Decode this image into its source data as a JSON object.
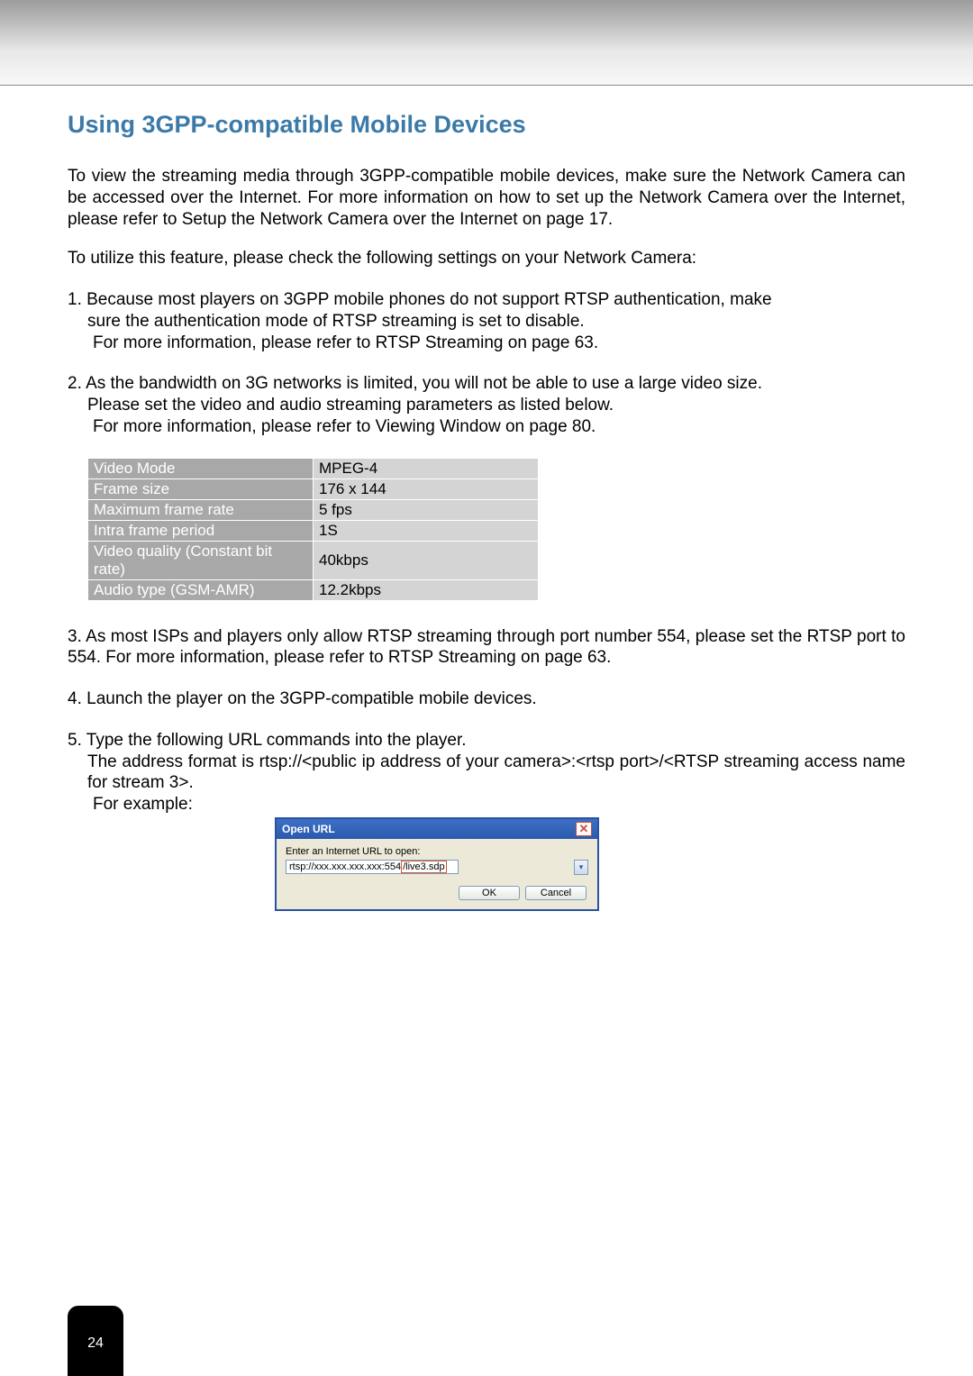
{
  "title": "Using 3GPP-compatible Mobile Devices",
  "intro": "To view the streaming media through 3GPP-compatible mobile devices, make sure the Network Camera can be accessed over the Internet. For more information on how to set up the Network Camera over the Internet, please refer to Setup the Network Camera over the Internet on page 17.",
  "lead": "To utilize this feature, please check the following settings on your Network Camera:",
  "item1_l1": "1. Because most players on 3GPP mobile phones do not support RTSP authentication, make",
  "item1_l2": "sure the authentication mode of RTSP streaming is set to disable.",
  "item1_l3": "For more information, please refer to RTSP Streaming on page 63.",
  "item2_l1": "2. As the bandwidth on 3G networks is limited, you will not be able to use a large video size.",
  "item2_l2": "Please set the video and audio streaming parameters as listed below.",
  "item2_l3": "For more information, please refer to Viewing Window on page 80.",
  "table": [
    {
      "label": "Video Mode",
      "value": "MPEG-4"
    },
    {
      "label": "Frame size",
      "value": "176 x 144"
    },
    {
      "label": "Maximum frame rate",
      "value": "5 fps"
    },
    {
      "label": "Intra frame period",
      "value": "1S"
    },
    {
      "label": "Video quality (Constant bit rate)",
      "value": "40kbps"
    },
    {
      "label": "Audio type (GSM-AMR)",
      "value": "12.2kbps"
    }
  ],
  "item3": "3. As most ISPs and players only allow RTSP streaming through port number 554, please set the RTSP port to 554. For more information, please refer to RTSP Streaming on page 63.",
  "item4": "4. Launch the player on the 3GPP-compatible mobile devices.",
  "item5_l1": "5. Type the following URL commands into the player.",
  "item5_l2": "The address format is rtsp://<public ip address of your camera>:<rtsp port>/<RTSP streaming access name for stream 3>.",
  "item5_l3": "For example:",
  "dialog": {
    "title": "Open URL",
    "close": "✕",
    "label": "Enter an Internet URL to open:",
    "url_prefix": "rtsp://xxx.xxx.xxx.xxx:554",
    "url_highlight": "/live3.sdp",
    "dropdown_glyph": "▾",
    "ok": "OK",
    "cancel": "Cancel"
  },
  "page_number": "24"
}
